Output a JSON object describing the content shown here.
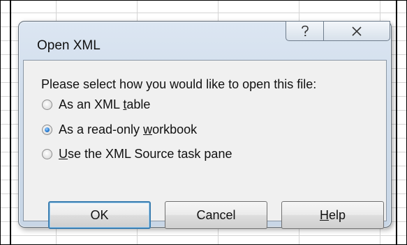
{
  "dialog": {
    "title": "Open XML",
    "prompt": "Please select how you would like to open this file:",
    "options": [
      {
        "pre": "As an XML ",
        "mnemonic": "t",
        "post": "able",
        "checked": false
      },
      {
        "pre": "As a read-only ",
        "mnemonic": "w",
        "post": "orkbook",
        "checked": true
      },
      {
        "pre": "",
        "mnemonic": "U",
        "post": "se the XML Source task pane",
        "checked": false
      }
    ],
    "buttons": {
      "ok": "OK",
      "cancel": "Cancel",
      "help_mnemonic": "H",
      "help_rest": "elp"
    }
  },
  "icons": {
    "help": "help-question-icon",
    "close": "close-x-icon"
  }
}
